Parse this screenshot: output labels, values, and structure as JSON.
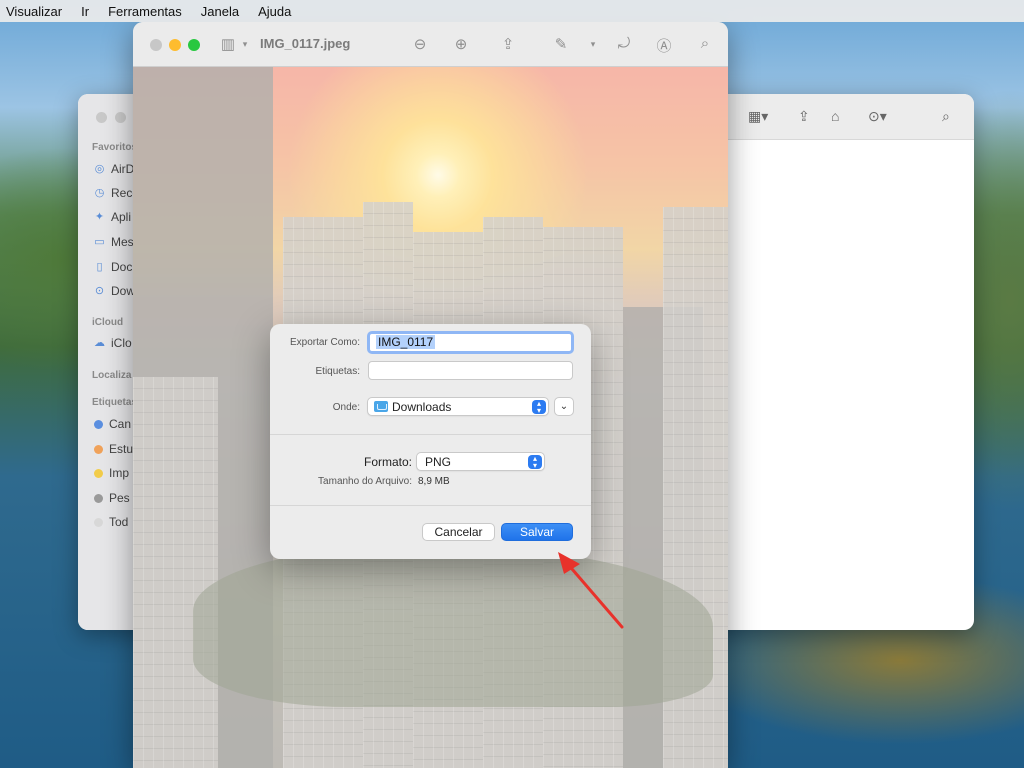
{
  "menubar": {
    "items": [
      "Visualizar",
      "Ir",
      "Ferramentas",
      "Janela",
      "Ajuda"
    ]
  },
  "finder": {
    "sections": {
      "favorites": "Favoritos",
      "icloud": "iCloud",
      "locations": "Localiza",
      "tags": "Etiquetas"
    },
    "favorites": [
      "AirD",
      "Rece",
      "Apli",
      "Mes",
      "Doc",
      "Dow"
    ],
    "icloud_items": [
      "iClo"
    ],
    "tags": [
      {
        "label": "Can",
        "color": "#5b8fe0"
      },
      {
        "label": "Estu",
        "color": "#f0a25a"
      },
      {
        "label": "Imp",
        "color": "#f2cc4a"
      },
      {
        "label": "Pes",
        "color": "#9a9a9a"
      },
      {
        "label": "Tod",
        "color": "#cfcfcf"
      }
    ]
  },
  "preview": {
    "title": "IMG_0117.jpeg",
    "lights": {
      "close": "#ff5f57",
      "minimize": "#febc2e",
      "zoom": "#28c840"
    }
  },
  "export_sheet": {
    "export_as_label": "Exportar Como:",
    "export_as_value": "IMG_0117",
    "tags_label": "Etiquetas:",
    "tags_value": "",
    "where_label": "Onde:",
    "where_value": "Downloads",
    "format_label": "Formato:",
    "format_value": "PNG",
    "filesize_label": "Tamanho do Arquivo:",
    "filesize_value": "8,9 MB",
    "cancel_label": "Cancelar",
    "save_label": "Salvar"
  },
  "annotation": {
    "arrow_color": "#e8322b"
  },
  "icons": {
    "sidebar_toggle": "sidebar-icon",
    "zoom_out": "zoom-out-icon",
    "zoom_in": "zoom-in-icon",
    "share": "share-icon",
    "markup": "pencil-icon",
    "rotate": "rotate-icon",
    "annotate": "markup-icon",
    "search": "search-icon"
  }
}
